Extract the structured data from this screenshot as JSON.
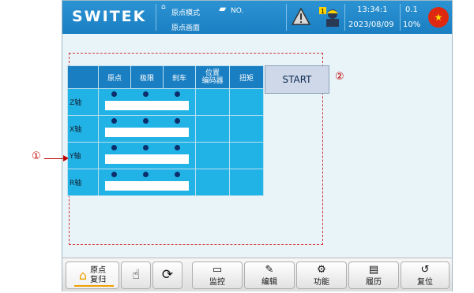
{
  "header": {
    "logo": "SWITEK",
    "mode_label": "原点模式",
    "screen_label": "原点画面",
    "no_label": "NO.",
    "time": "13:34:1",
    "date": "2023/08/09",
    "speed": "0.1",
    "percent": "10%",
    "user_level": "1"
  },
  "table": {
    "headers": [
      "原点",
      "极限",
      "刹车",
      "位置\n编码器",
      "扭矩"
    ],
    "rows": [
      {
        "axis": "Z轴"
      },
      {
        "axis": "X轴"
      },
      {
        "axis": "Y轴"
      },
      {
        "axis": "R轴"
      }
    ]
  },
  "start_button": "START",
  "annotations": {
    "circle1": "①",
    "circle2": "②"
  },
  "bottom": {
    "home_label_1": "原点",
    "home_label_2": "复归",
    "monitor": "监控",
    "edit": "编辑",
    "function": "功能",
    "history": "履历",
    "reset": "复位"
  },
  "colors": {
    "topbar": "#1a7fc2",
    "table_cell": "#22b3e6",
    "dot": "#0c2e6a",
    "annotation": "#c00000"
  }
}
